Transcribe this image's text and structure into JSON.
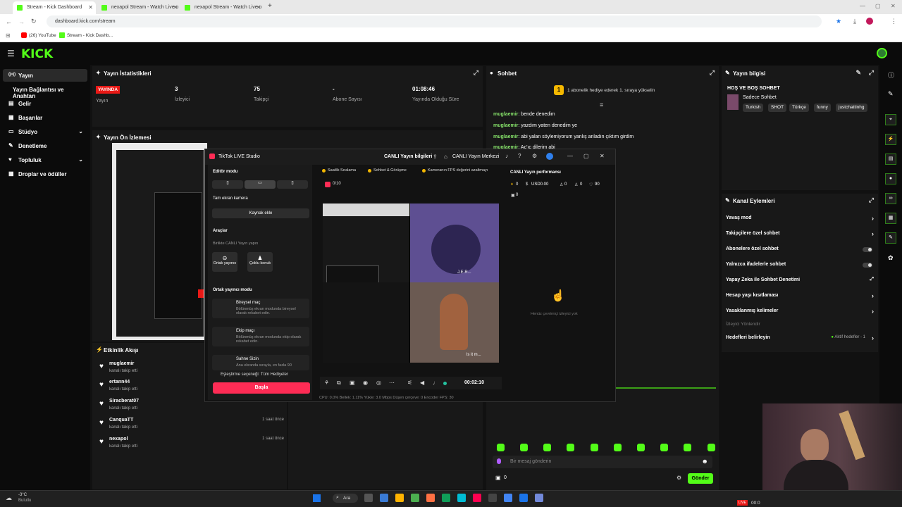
{
  "browser": {
    "tabs": [
      {
        "label": "Stream - Kick Dashboard",
        "active": true
      },
      {
        "label": "nexapol Stream - Watch Live o",
        "active": false
      },
      {
        "label": "nexapol Stream - Watch Live o",
        "active": false
      }
    ],
    "new_tab": "+",
    "url": "dashboard.kick.com/stream",
    "bookmarks": [
      "(26) YouTube",
      "Stream - Kick Dashb..."
    ]
  },
  "header": {
    "logo": "KICK"
  },
  "sidebar": {
    "items": [
      {
        "label": "Yayın",
        "icon": "broadcast-icon",
        "glyph": "((•))"
      },
      {
        "label": "Yayın Bağlantısı ve Anahtarı",
        "icon": "",
        "glyph": ""
      },
      {
        "label": "Gelir",
        "icon": "money-icon",
        "glyph": "▤"
      },
      {
        "label": "Başarılar",
        "icon": "achievements-icon",
        "glyph": "▦"
      },
      {
        "label": "Stüdyo",
        "icon": "studio-icon",
        "glyph": "▭"
      },
      {
        "label": "Denetleme",
        "icon": "moderation-icon",
        "glyph": "✎"
      },
      {
        "label": "Topluluk",
        "icon": "community-icon",
        "glyph": "♥"
      },
      {
        "label": "Droplar ve ödüller",
        "icon": "drops-icon",
        "glyph": "▦"
      }
    ]
  },
  "stats": {
    "title": "Yayın İstatistikleri",
    "live_badge": "YAYINDA",
    "live_label": "Yayın",
    "viewers_value": "3",
    "viewers_label": "İzleyici",
    "followers_value": "75",
    "followers_label": "Takipçi",
    "subs_value": "-",
    "subs_label": "Abone Sayısı",
    "uptime_value": "01:08:46",
    "uptime_label": "Yayında Olduğu Süre"
  },
  "preview": {
    "title": "Yayın Ön İzlemesi"
  },
  "activity": {
    "title": "Etkinlik Akışı",
    "items": [
      {
        "name": "muglaemir",
        "sub": "kanalı takip etti",
        "time": ""
      },
      {
        "name": "ertann44",
        "sub": "kanalı takip etti",
        "time": ""
      },
      {
        "name": "Siracberat07",
        "sub": "kanalı takip etti",
        "time": ""
      },
      {
        "name": "CanquaTT",
        "sub": "kanalı takip etti",
        "time": "1 saat önce"
      },
      {
        "name": "nexapol",
        "sub": "kanalı takip etti",
        "time": "1 saat önce"
      }
    ]
  },
  "chat": {
    "title": "Sohbet",
    "banner": "1 abonelik hediye ederek 1. sıraya yükselin",
    "messages": [
      {
        "user": "muglaemir",
        "text": "bende denedim"
      },
      {
        "user": "muglaemir",
        "text": "yazdım yaten denedim ye"
      },
      {
        "user": "muglaemir",
        "text": "abi yalan söylemiyorum yanlış anladın çıktım girdim"
      },
      {
        "user": "muglaemir",
        "text": "Aç'ıç dilerim abi"
      }
    ],
    "input_placeholder": "Bir mesaj gönderin",
    "points": "0",
    "send_label": "Gönder"
  },
  "stream_info": {
    "title": "Yayın bilgisi",
    "stream_title": "HOŞ VE BOŞ SOHBET",
    "category": "Sadece Sohbet",
    "tags": [
      "Turkish",
      "SHOT",
      "Türkçe",
      "funny",
      "justchattinhg"
    ]
  },
  "channel_actions": {
    "title": "Kanal Eylemleri",
    "items": [
      {
        "label": "Yavaş mod",
        "control": "chevron"
      },
      {
        "label": "Takipçilere özel sohbet",
        "control": "chevron"
      },
      {
        "label": "Abonelere özel sohbet",
        "control": "toggle"
      },
      {
        "label": "Yalnızca ifadelerle sohbet",
        "control": "toggle"
      },
      {
        "label": "Yapay Zeka ile Sohbet Denetimi",
        "control": "external"
      },
      {
        "label": "Hesap yaşı kısıtlaması",
        "control": "chevron"
      },
      {
        "label": "Yasaklanmış kelimeler",
        "control": "chevron"
      }
    ],
    "section": "İzleyici Yönlendir",
    "goals_label": "Hedefleri belirleyin",
    "goals_status": "Aktif hedefler - 1"
  },
  "tiktok": {
    "app_title": "TikTok LIVE Studio",
    "live_info": "CANLI Yayın bilgileri",
    "live_center": "CANLI Yayın Merkezi",
    "editor_mode": "Editör modu",
    "fullscreen_cam": "Tam ekran kamera",
    "add_source": "Kaynak ekle",
    "tools": "Araçlar",
    "collab_title": "Birlikte CANLI Yayın yapın",
    "co_host": "Ortak yayıncı",
    "multi_guest": "Çoklu konuk",
    "cohost_mode": "Ortak yayıncı modu",
    "solo_match": "Bireysel maç",
    "solo_desc": "Bölünmüş ekran modunda bireysel olarak rekabet edin.",
    "team_match": "Ekip maçı",
    "team_desc": "Bölünmüş ekran modunda ekip olarak rekabet edin.",
    "stage": "Sahne Sizin",
    "stage_desc": "Ana ekranda sırayla, en fazla 90",
    "match_option": "Eşleştirme seçeneği: Tüm Hediyeler",
    "start_label": "Başla",
    "chips": [
      "Saatlik Sıralama",
      "Sohbet & Görüşme",
      "Kameranın FPS değerini azaltmayı"
    ],
    "counter": "0/10",
    "perf_title": "CANLI Yayın performansı",
    "perf_stats": [
      "0",
      "USD0.00",
      "0",
      "0",
      "90",
      "0"
    ],
    "no_viewers": "Henüz çevrimiçi izleyici yok",
    "timer": "00:02:10",
    "status_bar": "CPU: 0.0%   Bellek: 1.11%   Yükle: 3.0 Mbps   Düşen çerçeve: 0   Encoder FPS: 30",
    "video_label_1": "J.E.R...",
    "video_label_2": "ls it m..."
  },
  "taskbar": {
    "weather_temp": "-3°C",
    "weather_desc": "Bulutlu",
    "search": "Ara",
    "live_tag": "LIVE",
    "clock": "00:0"
  },
  "colors": {
    "kick_green": "#53fc18",
    "live_red": "#e91916",
    "tiktok_pink": "#fe2c55"
  }
}
